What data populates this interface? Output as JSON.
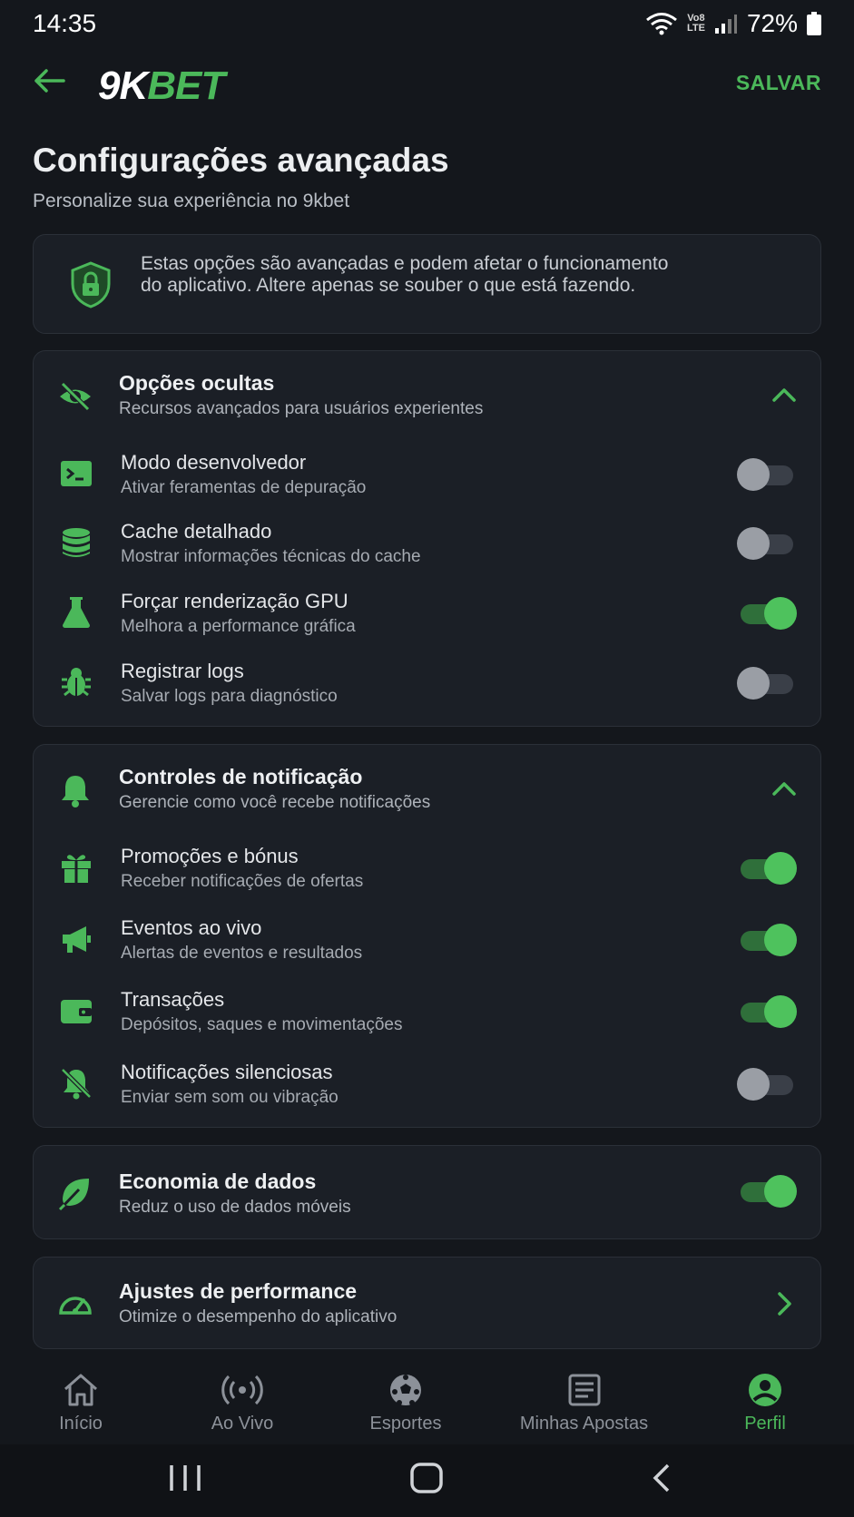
{
  "status": {
    "time": "14:35",
    "network": "Vo8\nLTE",
    "battery": "72%"
  },
  "header": {
    "logo_left": "9K",
    "logo_right": "BET",
    "save_label": "SALVAR"
  },
  "page": {
    "title": "Configurações avançadas",
    "subtitle": "Personalize sua experiência no 9kbet"
  },
  "warning": {
    "text": "Estas opções são avançadas e podem afetar o funcionamento do aplicativo. Altere apenas se souber o que está fazendo."
  },
  "hidden_options": {
    "title": "Opções ocultas",
    "subtitle": "Recursos avançados para usuários experientes",
    "items": [
      {
        "title": "Modo desenvolvedor",
        "subtitle": "Ativar feramentas de depuração",
        "enabled": false
      },
      {
        "title": "Cache detalhado",
        "subtitle": "Mostrar informações técnicas do cache",
        "enabled": false
      },
      {
        "title": "Forçar renderização GPU",
        "subtitle": "Melhora a performance gráfica",
        "enabled": true
      },
      {
        "title": "Registrar logs",
        "subtitle": "Salvar logs para diagnóstico",
        "enabled": false
      }
    ]
  },
  "notifications": {
    "title": "Controles de notificação",
    "subtitle": "Gerencie como você recebe notificações",
    "items": [
      {
        "title": "Promoções e bónus",
        "subtitle": "Receber notificações de ofertas",
        "enabled": true
      },
      {
        "title": "Eventos ao vivo",
        "subtitle": "Alertas de eventos e resultados",
        "enabled": true
      },
      {
        "title": "Transações",
        "subtitle": "Depósitos, saques e movimentações",
        "enabled": true
      },
      {
        "title": "Notificações silenciosas",
        "subtitle": "Enviar sem som ou vibração",
        "enabled": false
      }
    ]
  },
  "data_saver": {
    "title": "Economia de dados",
    "subtitle": "Reduz o uso de dados móveis",
    "enabled": true
  },
  "performance": {
    "title": "Ajustes de performance",
    "subtitle": "Otimize o desempenho do aplicativo"
  },
  "bottom_nav": {
    "items": [
      {
        "label": "Início",
        "icon": "home-icon"
      },
      {
        "label": "Ao Vivo",
        "icon": "live-broadcast-icon"
      },
      {
        "label": "Esportes",
        "icon": "soccer-ball-icon"
      },
      {
        "label": "Minhas Apostas",
        "icon": "bet-slip-icon"
      },
      {
        "label": "Perfil",
        "icon": "profile-icon",
        "active": true
      }
    ]
  },
  "colors": {
    "accent": "#4bb85a",
    "background": "#14171c",
    "card": "#1b1f26"
  }
}
